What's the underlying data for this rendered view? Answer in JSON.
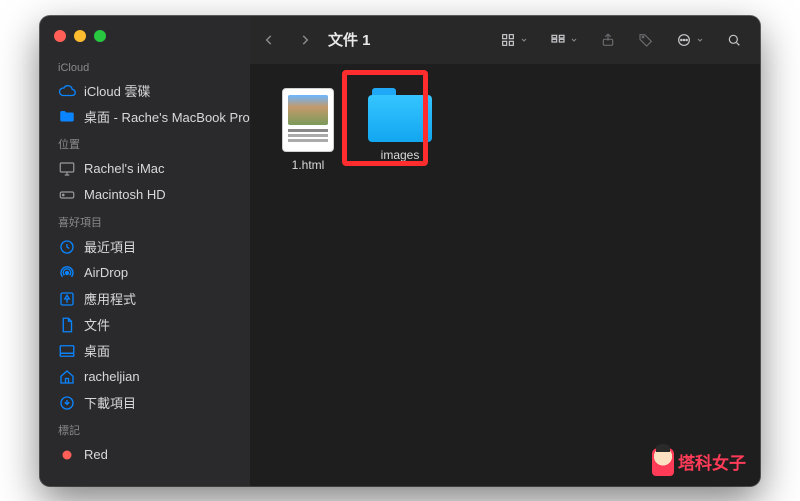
{
  "window_title": "文件 1",
  "sidebar": {
    "sections": [
      {
        "header": "iCloud",
        "items": [
          {
            "label": "iCloud 雲碟",
            "icon": "cloud-icon"
          },
          {
            "label": "桌面 - Rache's MacBook Pro",
            "icon": "folder-icon"
          }
        ]
      },
      {
        "header": "位置",
        "items": [
          {
            "label": "Rachel's iMac",
            "icon": "imac-icon"
          },
          {
            "label": "Macintosh HD",
            "icon": "hdd-icon"
          }
        ]
      },
      {
        "header": "喜好項目",
        "items": [
          {
            "label": "最近項目",
            "icon": "clock-icon"
          },
          {
            "label": "AirDrop",
            "icon": "airdrop-icon"
          },
          {
            "label": "應用程式",
            "icon": "apps-icon"
          },
          {
            "label": "文件",
            "icon": "document-icon"
          },
          {
            "label": "桌面",
            "icon": "desktop-icon"
          },
          {
            "label": "racheljian",
            "icon": "home-icon"
          },
          {
            "label": "下載項目",
            "icon": "download-icon"
          }
        ]
      },
      {
        "header": "標記",
        "items": [
          {
            "label": "Red",
            "icon": "tag-red-icon",
            "color": "#ff5f57"
          }
        ]
      }
    ]
  },
  "files": [
    {
      "name": "1.html",
      "kind": "html"
    },
    {
      "name": "images",
      "kind": "folder"
    }
  ],
  "highlight": {
    "target_file": "images"
  },
  "watermark": "塔科女子"
}
